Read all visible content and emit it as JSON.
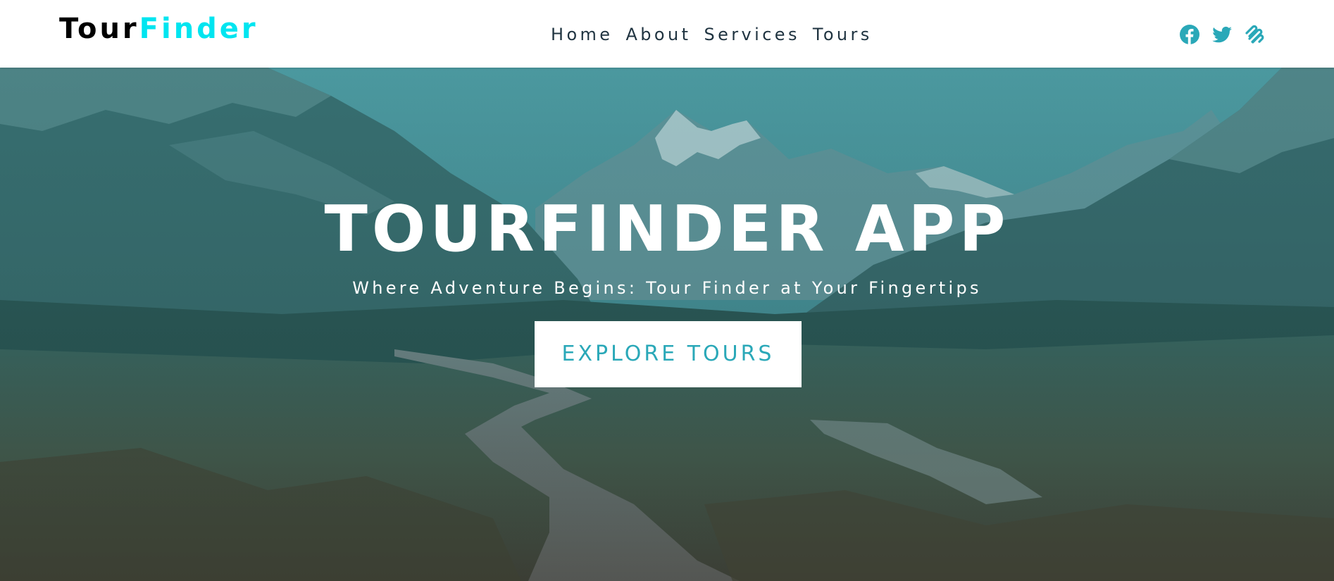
{
  "brand": {
    "part1": "Tour",
    "part2": "Finder",
    "accent_color": "#00e5f0"
  },
  "nav": {
    "items": [
      {
        "label": "Home"
      },
      {
        "label": "About"
      },
      {
        "label": "Services"
      },
      {
        "label": "Tours"
      }
    ]
  },
  "social": {
    "color": "#2aa8b8",
    "icons": [
      "facebook-icon",
      "twitter-icon",
      "squarespace-icon"
    ]
  },
  "hero": {
    "title": "TOURFINDER APP",
    "subtitle": "Where Adventure Begins: Tour Finder at Your Fingertips",
    "cta_label": "EXPLORE TOURS",
    "cta_color": "#2aa8b8",
    "overlay_color": "#1f6f78"
  }
}
